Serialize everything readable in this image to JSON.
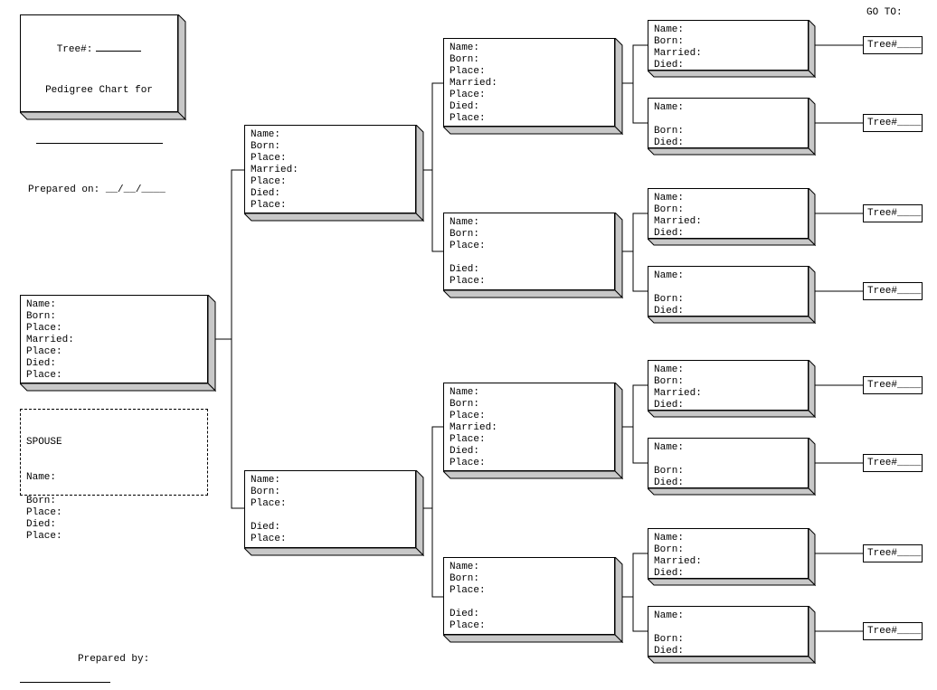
{
  "header": {
    "tree_label": "Tree#:",
    "chart_for": "Pedigree Chart for",
    "prepared_on": "Prepared on:",
    "date_fmt": "__/__/____"
  },
  "goto_label": "GO TO:",
  "fields_full": "Name:\nBorn:\nPlace:\nMarried:\nPlace:\nDied:\nPlace:",
  "fields_mother": "Name:\nBorn:\nPlace:\n\nDied:\nPlace:",
  "fields_g5_married": "Name:\nBorn:\nMarried:\nDied:",
  "fields_g5_plain": "Name:\n\nBorn:\nDied:",
  "spouse_label": "SPOUSE",
  "spouse_fields": "Name:\n\nBorn:\nPlace:\nDied:\nPlace:",
  "tree_ref": "Tree#____",
  "prepared_by": "Prepared by:"
}
